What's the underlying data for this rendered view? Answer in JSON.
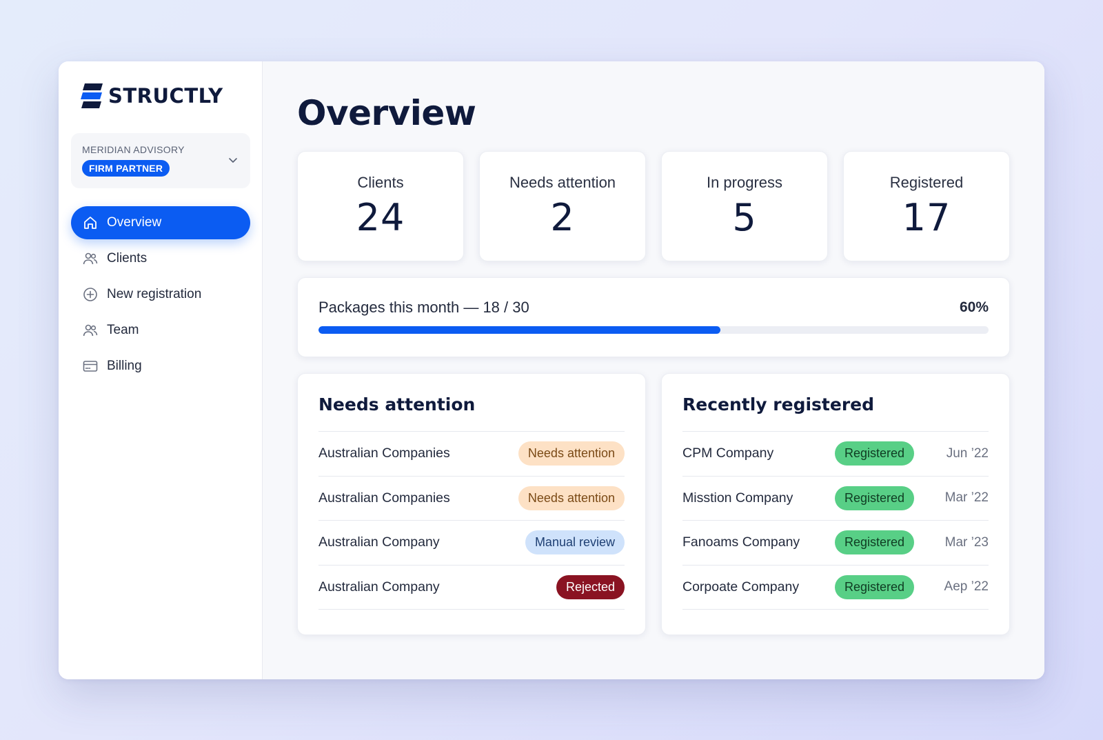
{
  "brand": {
    "name": "STRUCTLY",
    "accent": "#0b5cf2"
  },
  "firm": {
    "name": "MERIDIAN ADVISORY",
    "role": "FIRM PARTNER"
  },
  "nav": [
    {
      "label": "Overview",
      "icon": "home-icon",
      "active": true
    },
    {
      "label": "Clients",
      "icon": "users-icon",
      "active": false
    },
    {
      "label": "New registration",
      "icon": "plus-circle-icon",
      "active": false
    },
    {
      "label": "Team",
      "icon": "team-icon",
      "active": false
    },
    {
      "label": "Billing",
      "icon": "credit-card-icon",
      "active": false
    }
  ],
  "page": {
    "title": "Overview"
  },
  "stats": [
    {
      "label": "Clients",
      "value": "24"
    },
    {
      "label": "Needs attention",
      "value": "2"
    },
    {
      "label": "In progress",
      "value": "5"
    },
    {
      "label": "Registered",
      "value": "17"
    }
  ],
  "packages": {
    "label": "Packages this month — 18 / 30",
    "percent_label": "60%",
    "fraction": 0.6
  },
  "needs_attention": {
    "title": "Needs attention",
    "rows": [
      {
        "name": "Australian Companies",
        "status": "Needs attention"
      },
      {
        "name": "Australian Companies",
        "status": "Needs attention"
      },
      {
        "name": "Australian Company",
        "status": "Manual review"
      },
      {
        "name": "Australian Company",
        "status": "Rejected"
      }
    ]
  },
  "recently_registered": {
    "title": "Recently registered",
    "rows": [
      {
        "name": "CPM Company",
        "status": "Registered",
        "date": "Jun ’22"
      },
      {
        "name": "Misstion Company",
        "status": "Registered",
        "date": "Mar ’22"
      },
      {
        "name": "Fanoams Company",
        "status": "Registered",
        "date": "Mar ’23"
      },
      {
        "name": "Corpoate Company",
        "status": "Registered",
        "date": "Aep ’22"
      }
    ]
  }
}
